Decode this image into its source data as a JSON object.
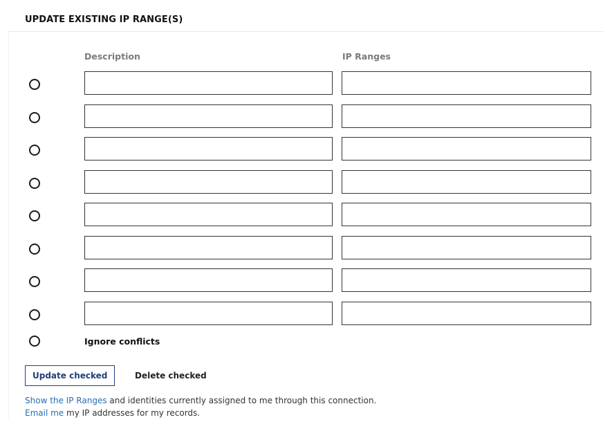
{
  "section": {
    "title": "UPDATE EXISTING IP RANGE(S)"
  },
  "columns": {
    "description": "Description",
    "ip_ranges": "IP Ranges"
  },
  "rows": [
    {
      "description": "",
      "ip_range": ""
    },
    {
      "description": "",
      "ip_range": ""
    },
    {
      "description": "",
      "ip_range": ""
    },
    {
      "description": "",
      "ip_range": ""
    },
    {
      "description": "",
      "ip_range": ""
    },
    {
      "description": "",
      "ip_range": ""
    },
    {
      "description": "",
      "ip_range": ""
    },
    {
      "description": "",
      "ip_range": ""
    }
  ],
  "ignore_conflicts": {
    "label": "Ignore conflicts",
    "checked": false
  },
  "buttons": {
    "update": "Update checked",
    "delete": "Delete checked"
  },
  "footer": {
    "line1_link": "Show the IP Ranges",
    "line1_text": " and identities currently assigned to me through this connection.",
    "line2_link": "Email me",
    "line2_text": " my IP addresses for my records."
  },
  "colors": {
    "link": "#2a6db5",
    "primary_button_border": "#1f3f7a",
    "column_header": "#7a7a7a"
  }
}
